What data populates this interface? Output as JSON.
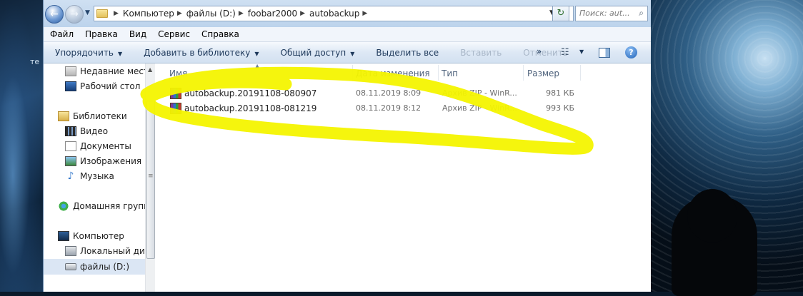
{
  "desktop": {
    "left_text": "те"
  },
  "window": {
    "address": {
      "crumbs": [
        "Компьютер",
        "файлы (D:)",
        "foobar2000",
        "autobackup"
      ],
      "search_placeholder": "Поиск: aut..."
    },
    "menu": [
      "Файл",
      "Правка",
      "Вид",
      "Сервис",
      "Справка"
    ],
    "toolbar": {
      "organize": "Упорядочить",
      "add_to_library": "Добавить в библиотеку",
      "share": "Общий доступ",
      "select_all": "Выделить все",
      "paste": "Вставить",
      "undo": "Отменить",
      "more": "»"
    },
    "nav_pane": {
      "recent": "Недавние места",
      "desktop": "Рабочий стол",
      "libraries": "Библиотеки",
      "video": "Видео",
      "documents": "Документы",
      "images": "Изображения",
      "music": "Музыка",
      "homegroup": "Домашняя группа",
      "computer": "Компьютер",
      "local_disk": "Локальный диск",
      "drive_d": "файлы (D:)"
    },
    "file_list": {
      "columns": {
        "name": "Имя",
        "date": "Дата изменения",
        "type": "Тип",
        "size": "Размер"
      },
      "files": [
        {
          "name": "autobackup.20191108-080907",
          "date": "08.11.2019 8:09",
          "type": "Архив ZIP - WinR...",
          "size": "981 КБ"
        },
        {
          "name": "autobackup.20191108-081219",
          "date": "08.11.2019 8:12",
          "type": "Архив ZIP - WinR...",
          "size": "993 КБ"
        }
      ]
    }
  },
  "colors": {
    "highlight": "#f4f400",
    "toolbar_text": "#1e395b",
    "selected_bg": "#dbe6f4"
  },
  "icons": [
    "back-arrow-icon",
    "forward-arrow-icon",
    "folder-icon",
    "refresh-icon",
    "search-icon",
    "views-icon",
    "preview-pane-icon",
    "help-icon",
    "winrar-archive-icon"
  ]
}
